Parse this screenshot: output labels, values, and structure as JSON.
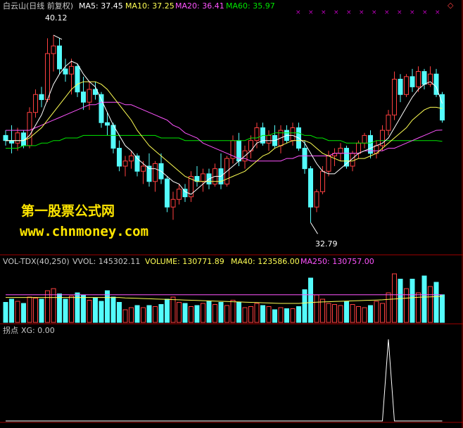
{
  "colors": {
    "background": "#000000",
    "up": "#ff4040",
    "down": "#54fcfc",
    "ma5": "#ffffff",
    "ma10": "#ffff54",
    "ma20": "#ff54ff",
    "ma60": "#00e600",
    "divider": "#a00000",
    "xg": "#ffffff",
    "watermark": "#ffe600"
  },
  "price_panel": {
    "stock_title": "白云山(日线 前复权)",
    "ma5": "MA5: 37.45",
    "ma10": "MA10: 37.25",
    "ma20": "MA20: 36.41",
    "ma60": "MA60: 35.97",
    "high_label": "40.12",
    "low_label": "32.79"
  },
  "volume_panel": {
    "indicator": "VOL-TDX(40,250)",
    "vvol": "VVOL: 145302.11",
    "volume": "VOLUME: 130771.89",
    "ma40": "MA40: 123586.00",
    "ma250": "MA250: 130757.00"
  },
  "signal_panel": {
    "title": "拐点",
    "xg": "XG: 0.00"
  },
  "watermark": {
    "line1": "第一股票公式网",
    "line2": "www.chnmoney.com"
  },
  "chart_data": [
    {
      "type": "candlestick",
      "title": "白云山(日线 前复权)",
      "ylim": [
        32.0,
        41.0
      ],
      "high": 40.12,
      "low": 32.79,
      "ohlc": [
        [
          36.2,
          36.4,
          35.8,
          36.0
        ],
        [
          36.0,
          36.6,
          35.5,
          35.9
        ],
        [
          35.9,
          36.5,
          35.6,
          36.3
        ],
        [
          36.3,
          36.4,
          35.7,
          35.8
        ],
        [
          35.8,
          37.3,
          35.7,
          37.1
        ],
        [
          37.1,
          38.0,
          36.9,
          37.8
        ],
        [
          37.8,
          38.1,
          37.3,
          37.6
        ],
        [
          37.6,
          40.0,
          37.5,
          39.4
        ],
        [
          39.4,
          40.12,
          38.7,
          39.7
        ],
        [
          39.7,
          40.0,
          38.6,
          38.8
        ],
        [
          38.8,
          39.2,
          38.3,
          38.6
        ],
        [
          38.6,
          39.2,
          37.8,
          38.9
        ],
        [
          38.9,
          39.0,
          37.7,
          37.9
        ],
        [
          37.9,
          38.5,
          37.2,
          37.5
        ],
        [
          37.5,
          38.3,
          37.2,
          38.0
        ],
        [
          38.0,
          38.3,
          37.6,
          37.8
        ],
        [
          37.8,
          37.9,
          36.5,
          36.7
        ],
        [
          36.7,
          37.1,
          36.2,
          36.6
        ],
        [
          36.6,
          36.7,
          35.5,
          35.7
        ],
        [
          35.7,
          36.0,
          34.8,
          35.0
        ],
        [
          35.0,
          35.4,
          34.6,
          35.2
        ],
        [
          35.2,
          35.6,
          34.9,
          35.4
        ],
        [
          35.4,
          35.5,
          34.6,
          34.8
        ],
        [
          34.8,
          35.2,
          34.3,
          35.0
        ],
        [
          35.0,
          35.5,
          34.2,
          34.4
        ],
        [
          34.4,
          35.2,
          34.0,
          35.1
        ],
        [
          35.1,
          35.5,
          34.3,
          34.5
        ],
        [
          34.5,
          34.6,
          33.2,
          33.4
        ],
        [
          33.4,
          34.0,
          32.9,
          33.7
        ],
        [
          33.7,
          34.3,
          33.5,
          34.1
        ],
        [
          34.1,
          34.3,
          33.6,
          33.8
        ],
        [
          33.8,
          34.8,
          33.6,
          34.6
        ],
        [
          34.6,
          35.0,
          34.2,
          34.4
        ],
        [
          34.4,
          34.9,
          34.0,
          34.7
        ],
        [
          34.7,
          34.9,
          34.1,
          34.3
        ],
        [
          34.3,
          35.1,
          34.2,
          34.9
        ],
        [
          34.9,
          35.5,
          34.1,
          34.3
        ],
        [
          34.3,
          35.4,
          34.2,
          35.3
        ],
        [
          35.3,
          36.2,
          35.1,
          36.0
        ],
        [
          36.0,
          36.3,
          35.0,
          35.2
        ],
        [
          35.2,
          35.8,
          34.9,
          35.6
        ],
        [
          35.6,
          36.2,
          35.3,
          36.0
        ],
        [
          36.0,
          36.7,
          35.7,
          36.5
        ],
        [
          36.5,
          36.7,
          35.8,
          35.9
        ],
        [
          35.9,
          36.4,
          35.6,
          36.2
        ],
        [
          36.2,
          36.6,
          35.7,
          35.8
        ],
        [
          35.8,
          36.6,
          35.5,
          36.4
        ],
        [
          36.4,
          36.6,
          35.9,
          36.0
        ],
        [
          36.0,
          36.7,
          35.8,
          36.5
        ],
        [
          36.5,
          36.7,
          35.6,
          35.7
        ],
        [
          35.7,
          36.0,
          34.7,
          34.9
        ],
        [
          34.9,
          35.0,
          32.79,
          33.4
        ],
        [
          33.4,
          34.1,
          33.2,
          34.0
        ],
        [
          34.0,
          35.0,
          33.9,
          34.8
        ],
        [
          34.8,
          35.6,
          34.6,
          35.4
        ],
        [
          35.4,
          35.7,
          35.0,
          35.5
        ],
        [
          35.5,
          35.9,
          35.2,
          35.7
        ],
        [
          35.7,
          35.8,
          34.9,
          35.0
        ],
        [
          35.0,
          35.6,
          34.8,
          35.5
        ],
        [
          35.5,
          36.0,
          35.3,
          35.9
        ],
        [
          35.9,
          36.3,
          35.7,
          36.2
        ],
        [
          36.2,
          36.4,
          35.3,
          35.5
        ],
        [
          35.5,
          36.0,
          35.3,
          35.8
        ],
        [
          35.8,
          36.6,
          35.6,
          36.4
        ],
        [
          36.4,
          37.2,
          36.2,
          37.0
        ],
        [
          37.0,
          38.7,
          36.8,
          38.4
        ],
        [
          38.4,
          38.6,
          37.5,
          37.8
        ],
        [
          37.8,
          38.6,
          37.7,
          38.5
        ],
        [
          38.5,
          38.8,
          37.9,
          38.1
        ],
        [
          38.1,
          38.9,
          37.9,
          38.7
        ],
        [
          38.7,
          38.8,
          38.0,
          38.2
        ],
        [
          38.2,
          38.9,
          38.1,
          38.6
        ],
        [
          38.6,
          38.8,
          37.7,
          37.8
        ],
        [
          37.8,
          37.9,
          36.7,
          36.8
        ]
      ],
      "ma5": [
        36.0,
        36.0,
        36.0,
        36.0,
        36.2,
        36.6,
        37.0,
        37.6,
        38.2,
        38.6,
        38.9,
        39.1,
        39.0,
        38.6,
        38.3,
        38.1,
        37.6,
        37.1,
        36.6,
        36.2,
        35.8,
        35.6,
        35.3,
        35.1,
        34.9,
        34.9,
        34.8,
        34.6,
        34.4,
        34.3,
        34.0,
        33.9,
        34.1,
        34.3,
        34.5,
        34.6,
        34.6,
        34.8,
        35.0,
        35.2,
        35.4,
        35.6,
        35.9,
        36.0,
        36.0,
        36.0,
        36.1,
        36.2,
        36.2,
        36.1,
        35.9,
        35.5,
        35.1,
        34.8,
        34.7,
        34.7,
        34.9,
        35.1,
        35.3,
        35.5,
        35.6,
        35.7,
        35.8,
        35.9,
        36.1,
        36.5,
        36.9,
        37.3,
        37.7,
        38.0,
        38.2,
        38.3,
        38.1,
        37.45
      ],
      "ma10": [
        36.0,
        36.0,
        36.0,
        36.0,
        36.1,
        36.3,
        36.5,
        36.8,
        37.1,
        37.4,
        37.7,
        38.0,
        38.2,
        38.3,
        38.3,
        38.3,
        38.2,
        38.0,
        37.7,
        37.4,
        37.1,
        36.8,
        36.4,
        36.1,
        35.8,
        35.6,
        35.4,
        35.2,
        35.0,
        34.8,
        34.6,
        34.5,
        34.4,
        34.4,
        34.4,
        34.4,
        34.4,
        34.5,
        34.6,
        34.7,
        34.8,
        35.0,
        35.2,
        35.4,
        35.5,
        35.7,
        35.8,
        35.9,
        36.0,
        36.0,
        36.0,
        35.9,
        35.7,
        35.5,
        35.4,
        35.3,
        35.2,
        35.2,
        35.2,
        35.3,
        35.3,
        35.4,
        35.5,
        35.7,
        35.9,
        36.1,
        36.3,
        36.5,
        36.8,
        37.0,
        37.2,
        37.3,
        37.3,
        37.25
      ],
      "ma20": [
        36.4,
        36.4,
        36.4,
        36.4,
        36.4,
        36.5,
        36.6,
        36.7,
        36.8,
        36.9,
        37.0,
        37.1,
        37.2,
        37.3,
        37.4,
        37.4,
        37.5,
        37.5,
        37.5,
        37.5,
        37.4,
        37.4,
        37.3,
        37.2,
        37.1,
        37.0,
        36.9,
        36.8,
        36.6,
        36.5,
        36.3,
        36.2,
        36.1,
        35.9,
        35.8,
        35.7,
        35.6,
        35.5,
        35.4,
        35.3,
        35.3,
        35.2,
        35.2,
        35.2,
        35.2,
        35.2,
        35.2,
        35.3,
        35.3,
        35.4,
        35.4,
        35.4,
        35.4,
        35.4,
        35.4,
        35.5,
        35.5,
        35.5,
        35.5,
        35.5,
        35.6,
        35.6,
        35.6,
        35.6,
        35.7,
        35.7,
        35.8,
        35.9,
        36.0,
        36.1,
        36.2,
        36.3,
        36.4,
        36.41
      ],
      "ma60": [
        35.7,
        35.7,
        35.7,
        35.8,
        35.8,
        35.8,
        35.9,
        35.9,
        36.0,
        36.0,
        36.1,
        36.1,
        36.1,
        36.2,
        36.2,
        36.2,
        36.2,
        36.2,
        36.2,
        36.2,
        36.2,
        36.2,
        36.2,
        36.2,
        36.2,
        36.2,
        36.1,
        36.1,
        36.1,
        36.1,
        36.0,
        36.0,
        36.0,
        36.0,
        36.0,
        36.0,
        36.0,
        36.0,
        36.0,
        36.0,
        36.0,
        36.1,
        36.1,
        36.2,
        36.2,
        36.3,
        36.3,
        36.3,
        36.3,
        36.3,
        36.2,
        36.2,
        36.1,
        36.1,
        36.0,
        36.0,
        36.0,
        35.9,
        35.9,
        35.9,
        35.9,
        35.9,
        36.0,
        36.0,
        36.0,
        36.0,
        36.0,
        36.0,
        36.0,
        36.0,
        36.0,
        36.0,
        36.0,
        35.97
      ]
    },
    {
      "type": "bar",
      "title": "VOL-TDX(40,250)",
      "ylim": [
        0,
        260000
      ],
      "values": [
        95000,
        110000,
        100000,
        90000,
        120000,
        115000,
        110000,
        150000,
        160000,
        135000,
        110000,
        125000,
        140000,
        130000,
        105000,
        115000,
        100000,
        150000,
        120000,
        95000,
        60000,
        70000,
        80000,
        70000,
        80000,
        75000,
        85000,
        110000,
        120000,
        95000,
        90000,
        75000,
        80000,
        90000,
        100000,
        85000,
        95000,
        80000,
        105000,
        95000,
        70000,
        75000,
        90000,
        80000,
        75000,
        60000,
        70000,
        65000,
        65000,
        75000,
        155000,
        210000,
        130000,
        110000,
        90000,
        85000,
        80000,
        100000,
        85000,
        75000,
        70000,
        80000,
        100000,
        90000,
        140000,
        230000,
        205000,
        160000,
        205000,
        140000,
        220000,
        170000,
        190000,
        130771.89
      ],
      "ma40": [
        118000,
        118000,
        118000,
        118000,
        118000,
        118000,
        118000,
        118000,
        118000,
        118000,
        118000,
        118000,
        118000,
        118000,
        118000,
        118000,
        118000,
        118000,
        118000,
        118000,
        116000,
        115000,
        114000,
        113000,
        112000,
        111000,
        110000,
        109000,
        108000,
        107000,
        106000,
        105000,
        104000,
        103000,
        102000,
        101000,
        100000,
        99000,
        98000,
        97000,
        96000,
        95000,
        94000,
        93000,
        92000,
        91000,
        90000,
        90000,
        90000,
        90000,
        92000,
        94000,
        96000,
        97000,
        98000,
        99000,
        100000,
        101000,
        102000,
        103000,
        104000,
        105000,
        106000,
        107000,
        109000,
        111000,
        113000,
        115000,
        117000,
        119000,
        120000,
        121000,
        122000,
        123586
      ],
      "ma250": [
        130757,
        130757,
        130757,
        130757,
        130757,
        130757,
        130757,
        130757,
        130757,
        130757,
        130757,
        130757,
        130757,
        130757,
        130757,
        130757,
        130757,
        130757,
        130757,
        130757,
        130757,
        130757,
        130757,
        130757,
        130757,
        130757,
        130757,
        130757,
        130757,
        130757,
        130757,
        130757,
        130757,
        130757,
        130757,
        130757,
        130757,
        130757,
        130757,
        130757,
        130757,
        130757,
        130757,
        130757,
        130757,
        130757,
        130757,
        130757,
        130757,
        130757,
        130757,
        130757,
        130757,
        130757,
        130757,
        130757,
        130757,
        130757,
        130757,
        130757,
        130757,
        130757,
        130757,
        130757,
        130757,
        130757,
        130757,
        130757,
        130757,
        130757,
        130757,
        130757,
        130757,
        130757
      ]
    },
    {
      "type": "line",
      "title": "拐点",
      "ylim": [
        0,
        1
      ],
      "series": [
        {
          "name": "XG",
          "values": [
            0,
            0,
            0,
            0,
            0,
            0,
            0,
            0,
            0,
            0,
            0,
            0,
            0,
            0,
            0,
            0,
            0,
            0,
            0,
            0,
            0,
            0,
            0,
            0,
            0,
            0,
            0,
            0,
            0,
            0,
            0,
            0,
            0,
            0,
            0,
            0,
            0,
            0,
            0,
            0,
            0,
            0,
            0,
            0,
            0,
            0,
            0,
            0,
            0,
            0,
            0,
            0,
            0,
            0,
            0,
            0,
            0,
            0,
            0,
            0,
            0,
            0,
            0,
            0,
            1,
            0,
            0,
            0,
            0,
            0,
            0,
            0,
            0,
            0
          ]
        }
      ]
    }
  ]
}
